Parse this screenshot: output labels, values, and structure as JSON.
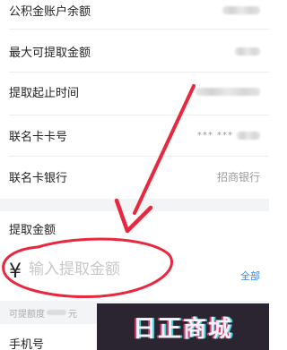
{
  "fields": {
    "fund_balance_label": "公积金账户余额",
    "max_withdraw_label": "最大可提取金额",
    "start_time_label": "提取起止时间",
    "card_no_label": "联名卡卡号",
    "card_no_value": "*** ***",
    "bank_label": "联名卡银行",
    "bank_value": "招商银行"
  },
  "amount_section": {
    "heading": "提取金额",
    "currency_symbol": "¥",
    "placeholder": "输入提取金额",
    "all_link": "全部",
    "limit_prefix": "可提额度",
    "limit_suffix": "元"
  },
  "phone_label": "手机号",
  "watermark_text": "日正商城",
  "colors": {
    "annotation_red": "#e8283f",
    "link_blue": "#3a86e6",
    "section_gap": "#f3f4f6"
  }
}
